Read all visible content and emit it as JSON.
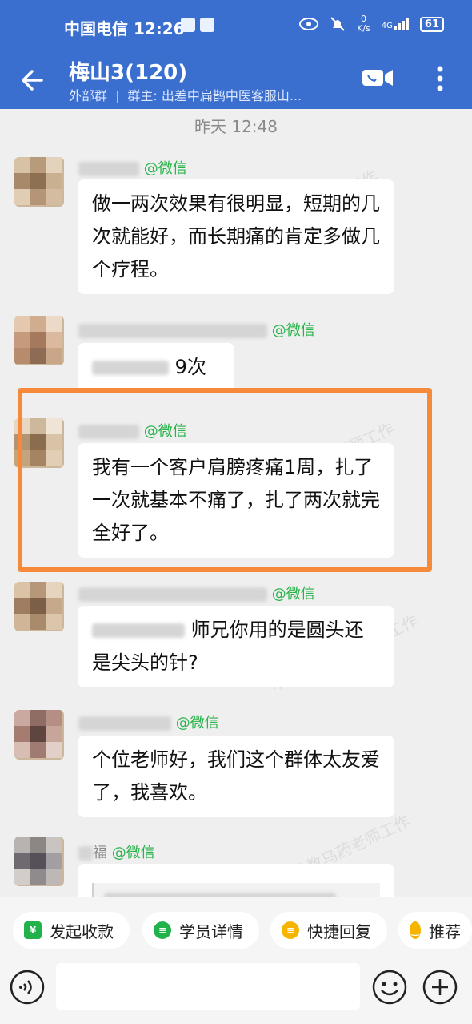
{
  "status_bar": {
    "carrier_time": "中国电信 12:26",
    "net_speed_top": "0",
    "net_speed_bottom": "K/s",
    "signal_label": "4G",
    "battery": "61"
  },
  "header": {
    "title": "梅山3(120)",
    "tag": "外部群",
    "owner": "群主: 出差中扁鹊中医客服山..."
  },
  "chat": {
    "timestamp": "昨天  12:48",
    "messages": [
      {
        "source": "@微信",
        "text": "做一两次效果有很明显，短期的几次就能好，而长期痛的肯定多做几个疗程。"
      },
      {
        "source": "@微信",
        "text": "9次"
      },
      {
        "source": "@微信",
        "text": "我有一个客户肩膀疼痛1周，扎了一次就基本不痛了，扎了两次就完全好了。"
      },
      {
        "source": "@微信",
        "text": "师兄你用的是圆头还是尖头的针?"
      },
      {
        "source": "@微信",
        "text": "个位老师好，我们这个群体太友爱了，我喜欢。"
      },
      {
        "source": "@微信",
        "name_suffix": "福",
        "text": ""
      }
    ]
  },
  "quick_actions": [
    {
      "label": "发起收款",
      "icon": "yen-icon",
      "color": "#22b24c"
    },
    {
      "label": "学员详情",
      "icon": "user-detail-icon",
      "color": "#22b24c"
    },
    {
      "label": "快捷回复",
      "icon": "quick-reply-icon",
      "color": "#f5b400"
    },
    {
      "label": "推荐",
      "icon": "recommend-icon",
      "color": "#f5b400"
    }
  ],
  "watermark": "中医助教乌药老师工作",
  "colors": {
    "header_bg": "#3a6fd0",
    "wechat_green": "#29b34a",
    "highlight": "#f68a3a"
  }
}
